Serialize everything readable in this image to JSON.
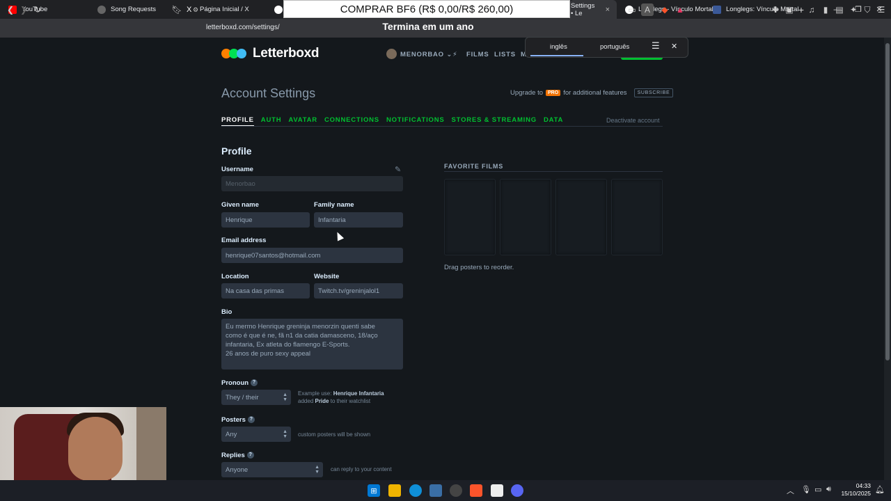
{
  "browser": {
    "tabs": [
      {
        "label": "YouTube",
        "color": "#ff0000"
      },
      {
        "label": "Song Requests",
        "color": "#555555"
      },
      {
        "label": "Página Inicial / X",
        "color": "#000000"
      },
      {
        "label": "",
        "color": "#4285f4"
      },
      {
        "label": "Settings • Le",
        "color": "#00c030"
      },
      {
        "label": "Longlegs - Vínculo Mortal",
        "color": "#4285f4"
      },
      {
        "label": "Longlegs: Vínculo Mortal",
        "color": "#3b5998"
      }
    ],
    "new_tab": "+",
    "close_tab": "×",
    "url": "letterboxd.com/settings/"
  },
  "overlay": {
    "promo": "COMPRAR BF6 (R$ 0,00/R$ 260,00)",
    "subtitle": "Termina em um ano"
  },
  "translate": {
    "lang_from": "inglês",
    "lang_to": "português"
  },
  "site": {
    "logo_text": "Letterboxd",
    "logo_colors": [
      "#ff8000",
      "#00e054",
      "#40bcf4"
    ],
    "user": "MENORBAO",
    "nav": [
      "FILMS",
      "LISTS",
      "M"
    ]
  },
  "settings": {
    "title": "Account Settings",
    "upgrade_pre": "Upgrade to",
    "pro_badge": "PRO",
    "upgrade_post": "for additional features",
    "subscribe": "SUBSCRIBE",
    "tabs": [
      "PROFILE",
      "AUTH",
      "AVATAR",
      "CONNECTIONS",
      "NOTIFICATIONS",
      "STORES & STREAMING",
      "DATA"
    ],
    "deactivate": "Deactivate account",
    "accent": "#00c030"
  },
  "profile": {
    "heading": "Profile",
    "username_label": "Username",
    "username_value": "Menorbao",
    "given_label": "Given name",
    "given_value": "Henrique",
    "family_label": "Family name",
    "family_value": "Infantaria",
    "email_label": "Email address",
    "email_value": "henrique07santos@hotmail.com",
    "location_label": "Location",
    "location_value": "Na casa das primas",
    "website_label": "Website",
    "website_value": "Twitch.tv/greninjalol1",
    "bio_label": "Bio",
    "bio_value": "Eu mermo Henrique greninja menorzin quenti sabe\ncomo é que é ne, fã n1 da catia damasceno, 18/aço\ninfantaria, Ex atleta do flamengo E-Sports.\n26 anos de puro sexy appeal",
    "pronoun_label": "Pronoun",
    "pronoun_value": "They / their",
    "pronoun_hint_pre": "Example use:",
    "pronoun_hint_name": "Henrique Infantaria",
    "pronoun_hint_mid": "added",
    "pronoun_hint_film": "Pride",
    "pronoun_hint_post": "to their watchlist",
    "posters_label": "Posters",
    "posters_value": "Any",
    "posters_hint": "custom posters will be shown",
    "replies_label": "Replies",
    "replies_value": "Anyone",
    "replies_hint": "can reply to your content",
    "help_glyph": "?"
  },
  "favorites": {
    "heading": "FAVORITE FILMS",
    "hint": "Drag posters to reorder."
  },
  "system": {
    "time": "04:33",
    "date": "15/10/2025"
  }
}
